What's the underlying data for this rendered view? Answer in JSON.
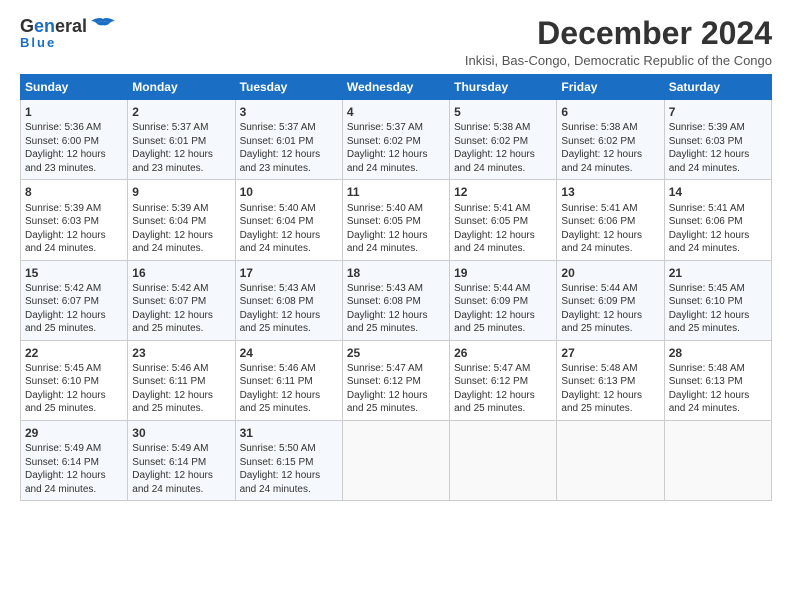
{
  "logo": {
    "line1": "General",
    "line2": "Blue"
  },
  "header": {
    "title": "December 2024",
    "subtitle": "Inkisi, Bas-Congo, Democratic Republic of the Congo"
  },
  "columns": [
    "Sunday",
    "Monday",
    "Tuesday",
    "Wednesday",
    "Thursday",
    "Friday",
    "Saturday"
  ],
  "weeks": [
    [
      {
        "day": "1",
        "sunrise": "Sunrise: 5:36 AM",
        "sunset": "Sunset: 6:00 PM",
        "daylight": "Daylight: 12 hours and 23 minutes."
      },
      {
        "day": "2",
        "sunrise": "Sunrise: 5:37 AM",
        "sunset": "Sunset: 6:01 PM",
        "daylight": "Daylight: 12 hours and 23 minutes."
      },
      {
        "day": "3",
        "sunrise": "Sunrise: 5:37 AM",
        "sunset": "Sunset: 6:01 PM",
        "daylight": "Daylight: 12 hours and 23 minutes."
      },
      {
        "day": "4",
        "sunrise": "Sunrise: 5:37 AM",
        "sunset": "Sunset: 6:02 PM",
        "daylight": "Daylight: 12 hours and 24 minutes."
      },
      {
        "day": "5",
        "sunrise": "Sunrise: 5:38 AM",
        "sunset": "Sunset: 6:02 PM",
        "daylight": "Daylight: 12 hours and 24 minutes."
      },
      {
        "day": "6",
        "sunrise": "Sunrise: 5:38 AM",
        "sunset": "Sunset: 6:02 PM",
        "daylight": "Daylight: 12 hours and 24 minutes."
      },
      {
        "day": "7",
        "sunrise": "Sunrise: 5:39 AM",
        "sunset": "Sunset: 6:03 PM",
        "daylight": "Daylight: 12 hours and 24 minutes."
      }
    ],
    [
      {
        "day": "8",
        "sunrise": "Sunrise: 5:39 AM",
        "sunset": "Sunset: 6:03 PM",
        "daylight": "Daylight: 12 hours and 24 minutes."
      },
      {
        "day": "9",
        "sunrise": "Sunrise: 5:39 AM",
        "sunset": "Sunset: 6:04 PM",
        "daylight": "Daylight: 12 hours and 24 minutes."
      },
      {
        "day": "10",
        "sunrise": "Sunrise: 5:40 AM",
        "sunset": "Sunset: 6:04 PM",
        "daylight": "Daylight: 12 hours and 24 minutes."
      },
      {
        "day": "11",
        "sunrise": "Sunrise: 5:40 AM",
        "sunset": "Sunset: 6:05 PM",
        "daylight": "Daylight: 12 hours and 24 minutes."
      },
      {
        "day": "12",
        "sunrise": "Sunrise: 5:41 AM",
        "sunset": "Sunset: 6:05 PM",
        "daylight": "Daylight: 12 hours and 24 minutes."
      },
      {
        "day": "13",
        "sunrise": "Sunrise: 5:41 AM",
        "sunset": "Sunset: 6:06 PM",
        "daylight": "Daylight: 12 hours and 24 minutes."
      },
      {
        "day": "14",
        "sunrise": "Sunrise: 5:41 AM",
        "sunset": "Sunset: 6:06 PM",
        "daylight": "Daylight: 12 hours and 24 minutes."
      }
    ],
    [
      {
        "day": "15",
        "sunrise": "Sunrise: 5:42 AM",
        "sunset": "Sunset: 6:07 PM",
        "daylight": "Daylight: 12 hours and 25 minutes."
      },
      {
        "day": "16",
        "sunrise": "Sunrise: 5:42 AM",
        "sunset": "Sunset: 6:07 PM",
        "daylight": "Daylight: 12 hours and 25 minutes."
      },
      {
        "day": "17",
        "sunrise": "Sunrise: 5:43 AM",
        "sunset": "Sunset: 6:08 PM",
        "daylight": "Daylight: 12 hours and 25 minutes."
      },
      {
        "day": "18",
        "sunrise": "Sunrise: 5:43 AM",
        "sunset": "Sunset: 6:08 PM",
        "daylight": "Daylight: 12 hours and 25 minutes."
      },
      {
        "day": "19",
        "sunrise": "Sunrise: 5:44 AM",
        "sunset": "Sunset: 6:09 PM",
        "daylight": "Daylight: 12 hours and 25 minutes."
      },
      {
        "day": "20",
        "sunrise": "Sunrise: 5:44 AM",
        "sunset": "Sunset: 6:09 PM",
        "daylight": "Daylight: 12 hours and 25 minutes."
      },
      {
        "day": "21",
        "sunrise": "Sunrise: 5:45 AM",
        "sunset": "Sunset: 6:10 PM",
        "daylight": "Daylight: 12 hours and 25 minutes."
      }
    ],
    [
      {
        "day": "22",
        "sunrise": "Sunrise: 5:45 AM",
        "sunset": "Sunset: 6:10 PM",
        "daylight": "Daylight: 12 hours and 25 minutes."
      },
      {
        "day": "23",
        "sunrise": "Sunrise: 5:46 AM",
        "sunset": "Sunset: 6:11 PM",
        "daylight": "Daylight: 12 hours and 25 minutes."
      },
      {
        "day": "24",
        "sunrise": "Sunrise: 5:46 AM",
        "sunset": "Sunset: 6:11 PM",
        "daylight": "Daylight: 12 hours and 25 minutes."
      },
      {
        "day": "25",
        "sunrise": "Sunrise: 5:47 AM",
        "sunset": "Sunset: 6:12 PM",
        "daylight": "Daylight: 12 hours and 25 minutes."
      },
      {
        "day": "26",
        "sunrise": "Sunrise: 5:47 AM",
        "sunset": "Sunset: 6:12 PM",
        "daylight": "Daylight: 12 hours and 25 minutes."
      },
      {
        "day": "27",
        "sunrise": "Sunrise: 5:48 AM",
        "sunset": "Sunset: 6:13 PM",
        "daylight": "Daylight: 12 hours and 25 minutes."
      },
      {
        "day": "28",
        "sunrise": "Sunrise: 5:48 AM",
        "sunset": "Sunset: 6:13 PM",
        "daylight": "Daylight: 12 hours and 24 minutes."
      }
    ],
    [
      {
        "day": "29",
        "sunrise": "Sunrise: 5:49 AM",
        "sunset": "Sunset: 6:14 PM",
        "daylight": "Daylight: 12 hours and 24 minutes."
      },
      {
        "day": "30",
        "sunrise": "Sunrise: 5:49 AM",
        "sunset": "Sunset: 6:14 PM",
        "daylight": "Daylight: 12 hours and 24 minutes."
      },
      {
        "day": "31",
        "sunrise": "Sunrise: 5:50 AM",
        "sunset": "Sunset: 6:15 PM",
        "daylight": "Daylight: 12 hours and 24 minutes."
      },
      {
        "day": "",
        "sunrise": "",
        "sunset": "",
        "daylight": ""
      },
      {
        "day": "",
        "sunrise": "",
        "sunset": "",
        "daylight": ""
      },
      {
        "day": "",
        "sunrise": "",
        "sunset": "",
        "daylight": ""
      },
      {
        "day": "",
        "sunrise": "",
        "sunset": "",
        "daylight": ""
      }
    ]
  ]
}
